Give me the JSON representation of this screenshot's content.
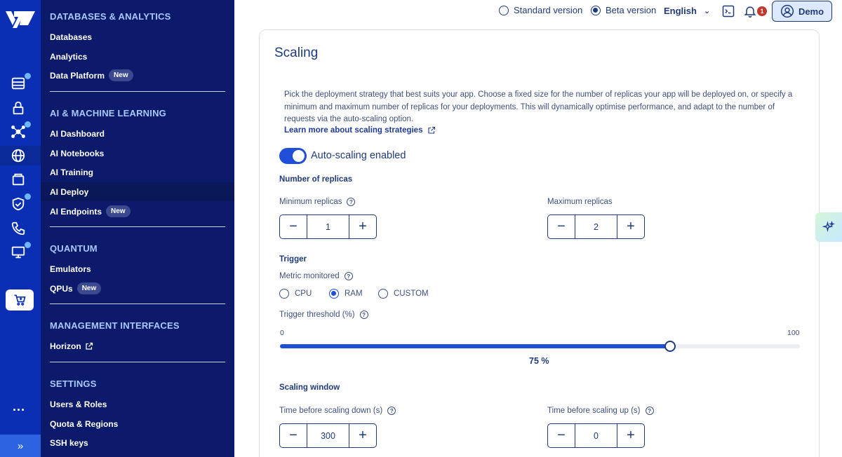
{
  "rail": {
    "icons": [
      "server-icon",
      "lock-icon",
      "network-icon",
      "globe-icon",
      "storage-icon",
      "shield-icon",
      "phone-icon",
      "monitor-icon",
      "cart-icon"
    ],
    "more": "...",
    "expand": "»"
  },
  "nav": {
    "sections": [
      {
        "title": "DATABASES & ANALYTICS",
        "items": [
          {
            "label": "Databases"
          },
          {
            "label": "Analytics"
          },
          {
            "label": "Data Platform",
            "badge": "New"
          }
        ]
      },
      {
        "title": "AI & MACHINE LEARNING",
        "items": [
          {
            "label": "AI Dashboard"
          },
          {
            "label": "AI Notebooks"
          },
          {
            "label": "AI Training"
          },
          {
            "label": "AI Deploy",
            "active": true
          },
          {
            "label": "AI Endpoints",
            "badge": "New"
          }
        ]
      },
      {
        "title": "QUANTUM",
        "items": [
          {
            "label": "Emulators"
          },
          {
            "label": "QPUs",
            "badge": "New"
          }
        ]
      },
      {
        "title": "MANAGEMENT INTERFACES",
        "items": [
          {
            "label": "Horizon",
            "external": true
          }
        ]
      },
      {
        "title": "SETTINGS",
        "items": [
          {
            "label": "Users & Roles"
          },
          {
            "label": "Quota & Regions"
          },
          {
            "label": "SSH keys"
          }
        ]
      }
    ]
  },
  "topbar": {
    "standard_version": "Standard version",
    "beta_version": "Beta version",
    "selected_version": "beta",
    "language": "English",
    "notification_count": "1",
    "user_button": "Demo"
  },
  "scaling": {
    "title": "Scaling",
    "description": "Pick the deployment strategy that best suits your app. Choose a fixed size for the number of replicas your app will be deployed on, or specify a minimum and maximum number of replicas for your deployments. This will dynamically optimise performance, and adapt to the number of requests via the auto-scaling option.",
    "learn_more": "Learn more about scaling strategies",
    "autoscaling_label": "Auto-scaling enabled",
    "autoscaling_enabled": true,
    "replicas_heading": "Number of replicas",
    "min_replicas_label": "Minimum replicas",
    "min_replicas_value": "1",
    "max_replicas_label": "Maximum replicas",
    "max_replicas_value": "2",
    "trigger_heading": "Trigger",
    "metric_label": "Metric monitored",
    "metric_options": [
      "CPU",
      "RAM",
      "CUSTOM"
    ],
    "metric_selected": "RAM",
    "threshold_label": "Trigger threshold (%)",
    "threshold_min": "0",
    "threshold_max": "100",
    "threshold_value": 75,
    "threshold_display": "75 %",
    "window_heading": "Scaling window",
    "scale_down_label": "Time before scaling down (s)",
    "scale_down_value": "300",
    "scale_up_label": "Time before scaling up (s)",
    "scale_up_value": "0"
  },
  "colors": {
    "rail": "#0a2fb5",
    "nav": "#0b1a6b",
    "accent": "#1f4fd6",
    "text": "#1f3a7a"
  }
}
